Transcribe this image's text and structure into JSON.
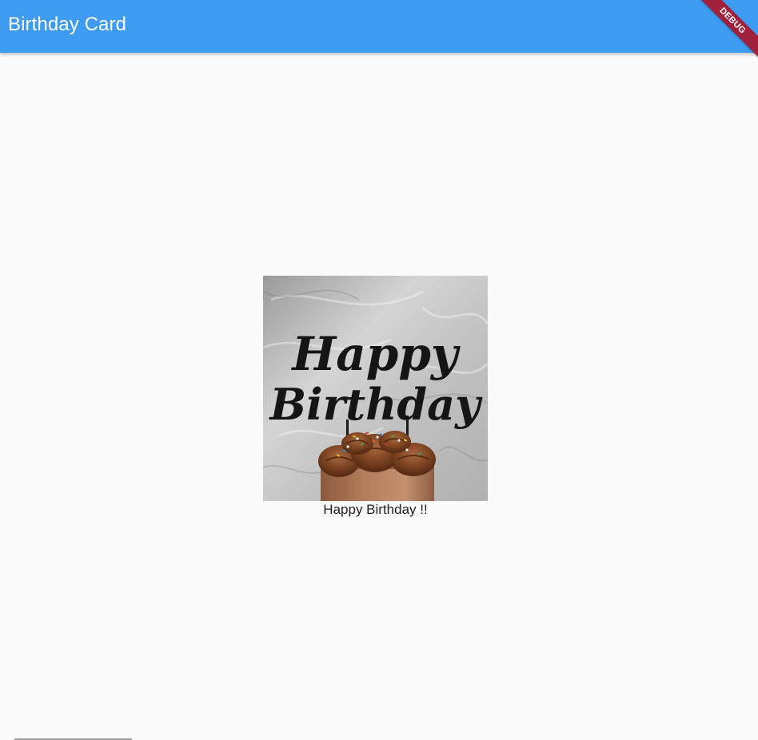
{
  "appbar": {
    "title": "Birthday Card",
    "color": "#3d9bf2"
  },
  "debug_banner": {
    "label": "DEBUG",
    "color": "#a1203c"
  },
  "card": {
    "image": {
      "topper_text_line1": "Happy",
      "topper_text_line2": "Birthday"
    },
    "caption": "Happy Birthday !!"
  }
}
